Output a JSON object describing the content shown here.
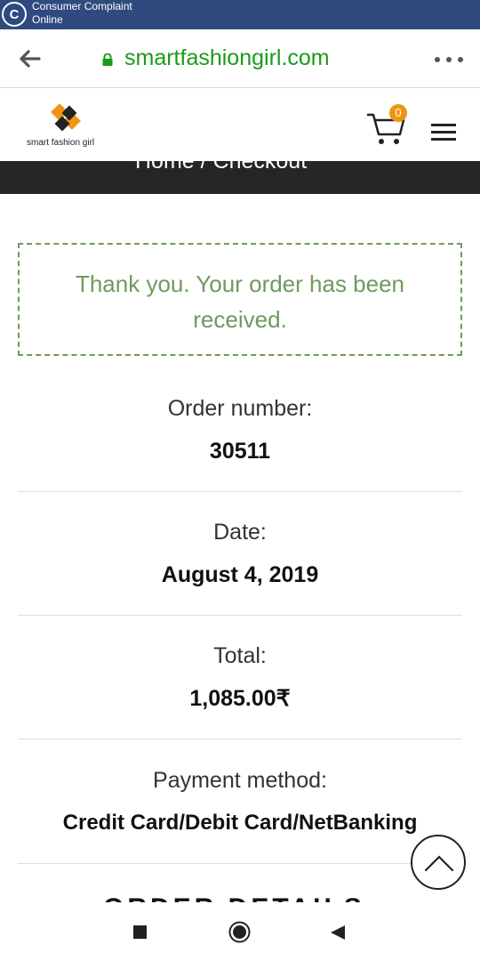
{
  "status_bar": {
    "app_initial": "C",
    "app_name_line1": "Consumer Complaint",
    "app_name_line2": "Online"
  },
  "browser": {
    "url": "smartfashiongirl.com",
    "icons": [
      "back-arrow-icon",
      "lock-icon",
      "more-options-icon"
    ]
  },
  "header": {
    "logo_text": "smart fashion girl",
    "cart_count": "0",
    "icons": [
      "cart-icon",
      "hamburger-menu-icon"
    ],
    "accent_color": "#f09512"
  },
  "breadcrumb": {
    "text": "Home / Checkout"
  },
  "notice": {
    "message": "Thank you. Your order has been received.",
    "color": "#6e9a5e"
  },
  "order": {
    "number_label": "Order number:",
    "number_value": "30511",
    "date_label": "Date:",
    "date_value": "August 4, 2019",
    "total_label": "Total:",
    "total_value": "1,085.00₹",
    "payment_label": "Payment method:",
    "payment_value": "Credit Card/Debit Card/NetBanking"
  },
  "section_heading": "ORDER DETAILS",
  "nav": {
    "icons": [
      "recent-apps-icon",
      "home-icon",
      "back-icon"
    ]
  }
}
